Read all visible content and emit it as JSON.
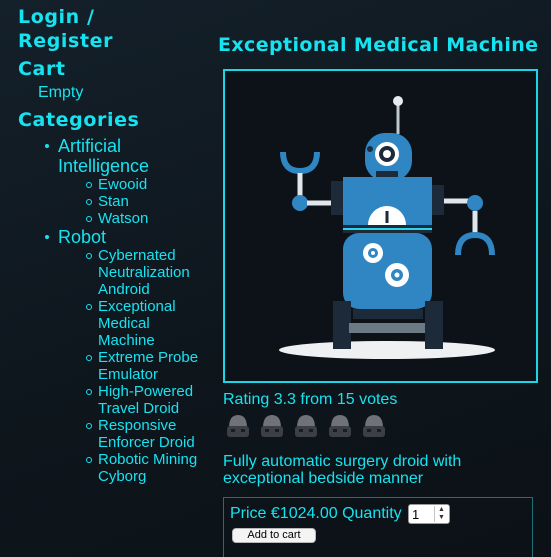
{
  "sidebar": {
    "login_register": "Login / Register",
    "cart_heading": "Cart",
    "cart_status": "Empty",
    "categories_heading": "Categories",
    "categories": [
      {
        "name": "Artificial Intelligence",
        "items": [
          "Ewooid",
          "Stan",
          "Watson"
        ]
      },
      {
        "name": "Robot",
        "items": [
          "Cybernated Neutralization Android",
          "Exceptional Medical Machine",
          "Extreme Probe Emulator",
          "High-Powered Travel Droid",
          "Responsive Enforcer Droid",
          "Robotic Mining Cyborg"
        ]
      }
    ]
  },
  "product": {
    "title": "Exceptional Medical Machine",
    "image_icon": "robot-illustration",
    "rating_text": "Rating 3.3 from 15 votes",
    "rating": {
      "value": 3.3,
      "max": 5,
      "icon": "robot-head-icon"
    },
    "description": "Fully automatic surgery droid with exceptional bedside manner",
    "price_label": "Price €1024.00 Quantity",
    "quantity": "1",
    "add_to_cart": "Add to cart"
  },
  "colors": {
    "accent": "#16e3f0",
    "background": "#0e161d",
    "robot_blue": "#2f86c3",
    "robot_dark": "#1d2a3a"
  }
}
